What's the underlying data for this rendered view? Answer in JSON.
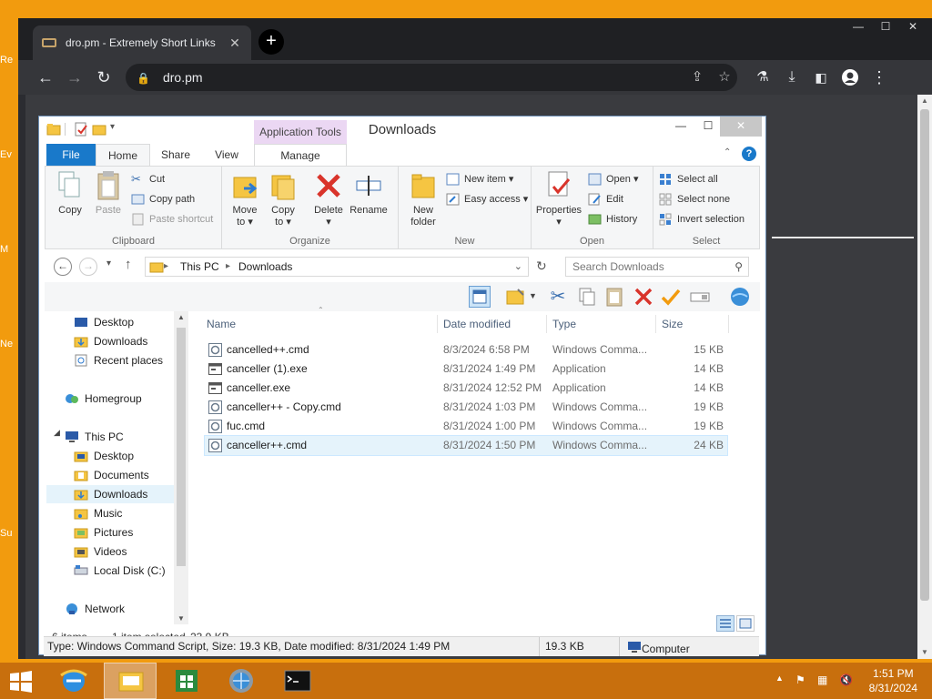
{
  "desktop": {
    "edge_fragments": [
      "Re",
      "Ev",
      "M",
      "Ne",
      "Su"
    ]
  },
  "browser": {
    "tab_title": "dro.pm - Extremely Short Links",
    "url": "dro.pm",
    "new_tab_symbol": "+"
  },
  "explorer": {
    "title": "Downloads",
    "context_tab": "Application Tools",
    "ribbon_tabs": [
      "File",
      "Home",
      "Share",
      "View",
      "Manage"
    ],
    "ribbon": {
      "clipboard": {
        "label": "Clipboard",
        "copy": "Copy",
        "paste": "Paste",
        "cut": "Cut",
        "copy_path": "Copy path",
        "paste_shortcut": "Paste shortcut"
      },
      "organize": {
        "label": "Organize",
        "move_to_1": "Move",
        "move_to_2": "to",
        "copy_to_1": "Copy",
        "copy_to_2": "to",
        "delete": "Delete",
        "rename": "Rename"
      },
      "new": {
        "label": "New",
        "new_folder_1": "New",
        "new_folder_2": "folder",
        "new_item": "New item",
        "easy_access": "Easy access"
      },
      "open": {
        "label": "Open",
        "properties": "Properties",
        "open": "Open",
        "edit": "Edit",
        "history": "History"
      },
      "select": {
        "label": "Select",
        "select_all": "Select all",
        "select_none": "Select none",
        "invert": "Invert selection"
      }
    },
    "address": {
      "crumbs": [
        "This PC",
        "Downloads"
      ],
      "search_placeholder": "Search Downloads"
    },
    "nav": {
      "items_top": [
        "Desktop",
        "Downloads",
        "Recent places"
      ],
      "homegroup": "Homegroup",
      "this_pc": "This PC",
      "pc_items": [
        "Desktop",
        "Documents",
        "Downloads",
        "Music",
        "Pictures",
        "Videos",
        "Local Disk (C:)"
      ],
      "network": "Network"
    },
    "columns": [
      "Name",
      "Date modified",
      "Type",
      "Size"
    ],
    "files": [
      {
        "name": "cancelled++.cmd",
        "date": "8/3/2024 6:58 PM",
        "type": "Windows Comma...",
        "size": "15 KB",
        "kind": "cmd"
      },
      {
        "name": "canceller (1).exe",
        "date": "8/31/2024 1:49 PM",
        "type": "Application",
        "size": "14 KB",
        "kind": "exe"
      },
      {
        "name": "canceller.exe",
        "date": "8/31/2024 12:52 PM",
        "type": "Application",
        "size": "14 KB",
        "kind": "exe"
      },
      {
        "name": "canceller++ - Copy.cmd",
        "date": "8/31/2024 1:03 PM",
        "type": "Windows Comma...",
        "size": "19 KB",
        "kind": "cmd"
      },
      {
        "name": "fuc.cmd",
        "date": "8/31/2024 1:00 PM",
        "type": "Windows Comma...",
        "size": "19 KB",
        "kind": "cmd"
      },
      {
        "name": "canceller++.cmd",
        "date": "8/31/2024 1:50 PM",
        "type": "Windows Comma...",
        "size": "24 KB",
        "kind": "cmd",
        "selected": true
      }
    ],
    "status": {
      "count": "6 items",
      "selected": "1 item selected",
      "selected_size": "23.9 KB"
    },
    "statusbar": {
      "details": "Type: Windows Command Script, Size: 19.3 KB, Date modified: 8/31/2024 1:49 PM",
      "size": "19.3 KB",
      "location": "Computer"
    }
  },
  "taskbar": {
    "time": "1:51 PM",
    "date": "8/31/2024"
  },
  "colors": {
    "desktop": "#f29b0e",
    "taskbar": "#c86f0d",
    "file_tab": "#1979ca",
    "context_tab": "#ebd7f3",
    "selection": "#e5f3fb"
  }
}
